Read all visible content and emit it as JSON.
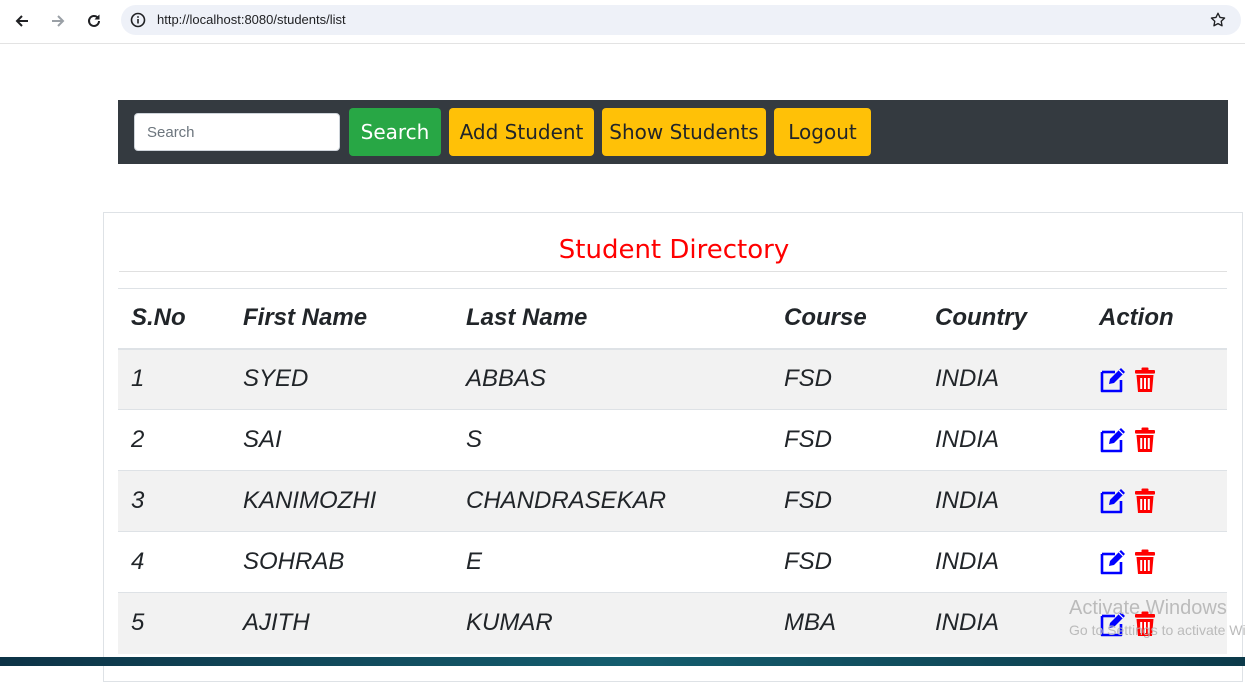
{
  "browser": {
    "url": "http://localhost:8080/students/list"
  },
  "navbar": {
    "search_placeholder": "Search",
    "search_button": "Search",
    "add_student_button": "Add Student",
    "show_students_button": "Show Students",
    "logout_button": "Logout"
  },
  "directory": {
    "title": "Student Directory",
    "columns": [
      "S.No",
      "First Name",
      "Last Name",
      "Course",
      "Country",
      "Action"
    ],
    "rows": [
      {
        "sno": "1",
        "first": "SYED",
        "last": "ABBAS",
        "course": "FSD",
        "country": "INDIA"
      },
      {
        "sno": "2",
        "first": "SAI",
        "last": "S",
        "course": "FSD",
        "country": "INDIA"
      },
      {
        "sno": "3",
        "first": "KANIMOZHI",
        "last": "CHANDRASEKAR",
        "course": "FSD",
        "country": "INDIA"
      },
      {
        "sno": "4",
        "first": "SOHRAB",
        "last": "E",
        "course": "FSD",
        "country": "INDIA"
      },
      {
        "sno": "5",
        "first": "AJITH",
        "last": "KUMAR",
        "course": "MBA",
        "country": "INDIA"
      }
    ],
    "action_icons": [
      "edit-icon",
      "trash-icon"
    ]
  },
  "watermark": {
    "title": "Activate Windows",
    "subtitle": "Go to Settings to activate Windows."
  },
  "colors": {
    "navbar_bg": "#343a40",
    "search_button": "#28a745",
    "nav_buttons": "#ffc107",
    "title": "#ff0000",
    "edit_icon": "#0000ff",
    "trash_icon": "#ff0000"
  }
}
